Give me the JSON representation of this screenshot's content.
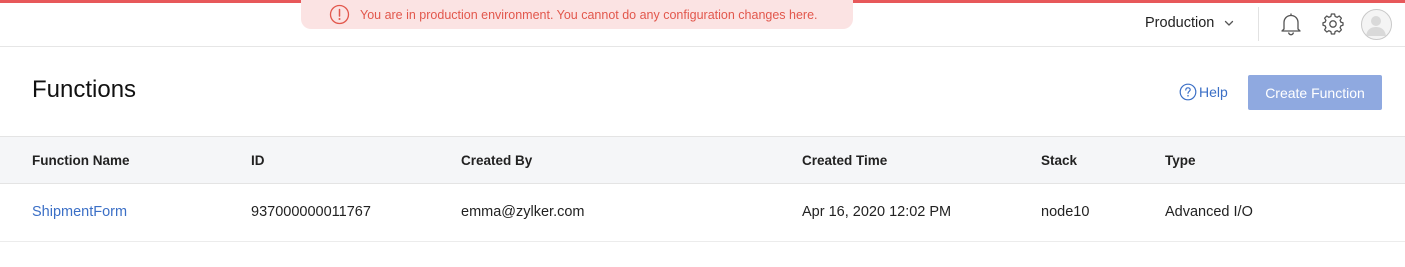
{
  "banner": {
    "text": "You are in production environment. You cannot do any configuration changes here.",
    "color": "#e2574c",
    "background": "#fbe3e3"
  },
  "header": {
    "environment": "Production",
    "icons": [
      "info-circle-icon",
      "chevron-down-icon",
      "bell-icon",
      "gear-icon",
      "avatar"
    ]
  },
  "page": {
    "title": "Functions",
    "help_label": "Help",
    "create_button_label": "Create Function"
  },
  "table": {
    "columns": [
      "Function Name",
      "ID",
      "Created By",
      "Created Time",
      "Stack",
      "Type"
    ],
    "rows": [
      {
        "name": "ShipmentForm",
        "id": "937000000011767",
        "created_by": "emma@zylker.com",
        "created_time": "Apr 16, 2020 12:02 PM",
        "stack": "node10",
        "type": "Advanced I/O"
      }
    ]
  },
  "colors": {
    "accent": "#e7585a",
    "link": "#3b6fc6",
    "primary_button": "#8fa9e0",
    "table_header_bg": "#f5f6f8"
  }
}
